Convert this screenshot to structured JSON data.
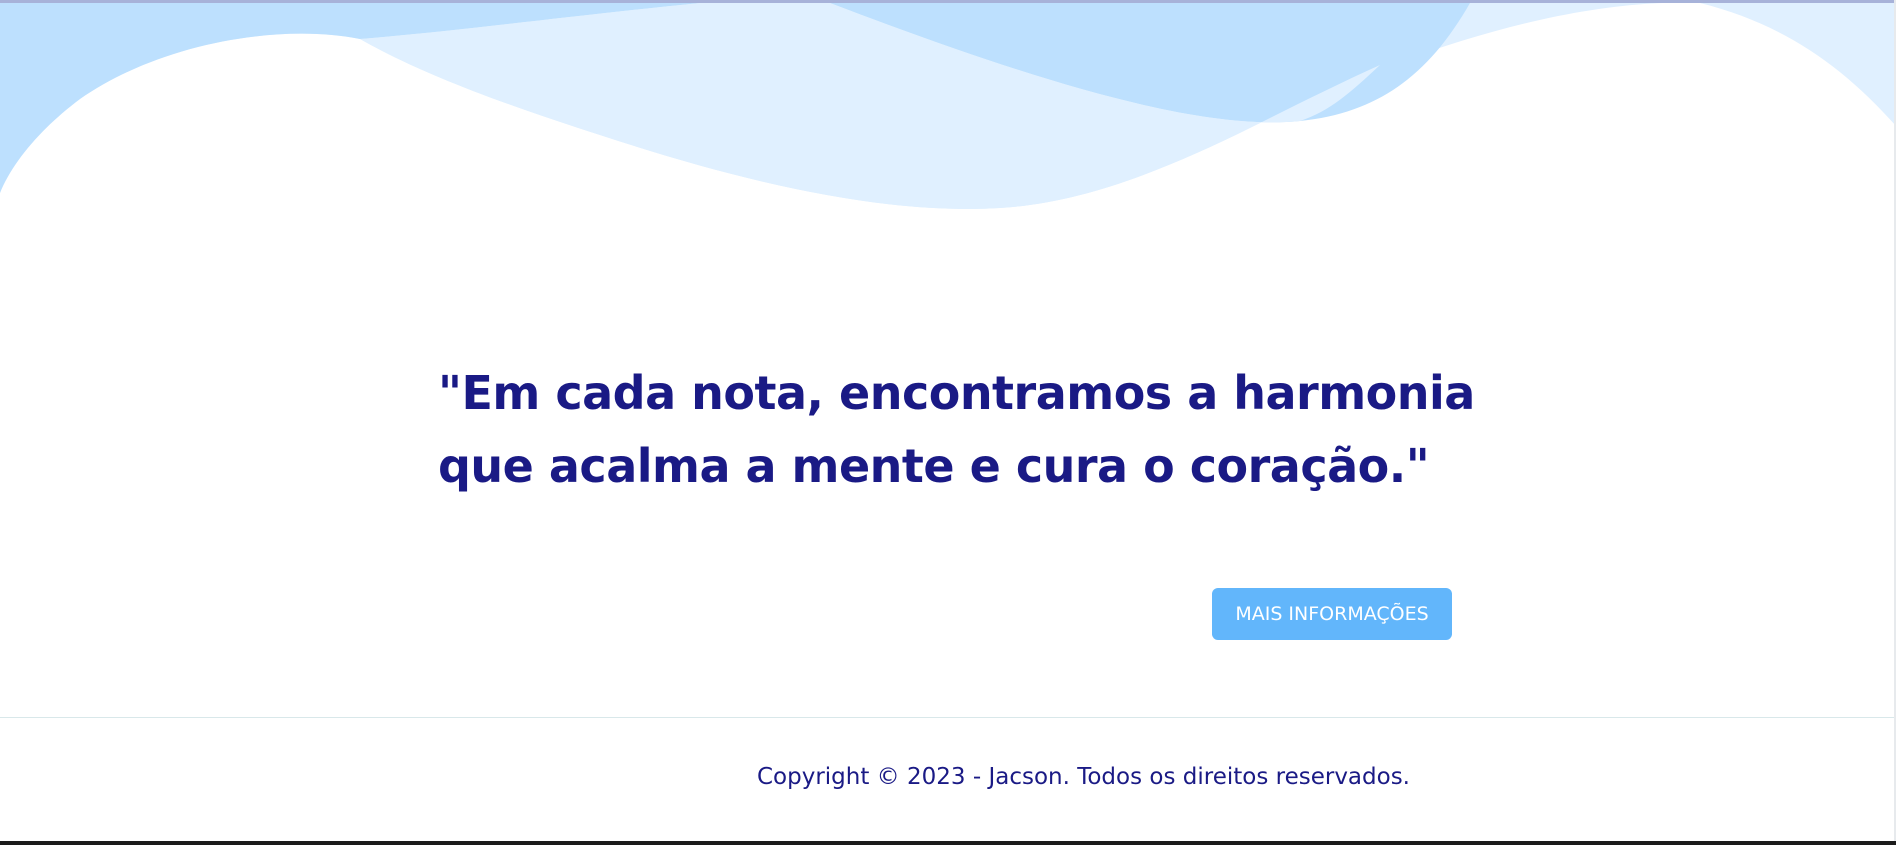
{
  "hero": {
    "quote_lines": "\"Em cada nota, encontramos a harmonia\nque acalma a mente e cura o coração.\"",
    "cta_label": "MAIS INFORMAÇÕES"
  },
  "footer": {
    "copyright": "Copyright © 2023 - Jacson. Todos os direitos reservados."
  },
  "colors": {
    "primary_text": "#1a1a85",
    "button_bg": "#62b6fb",
    "wave_light": "#e0f0ff",
    "wave_mid": "#bde0fe"
  }
}
